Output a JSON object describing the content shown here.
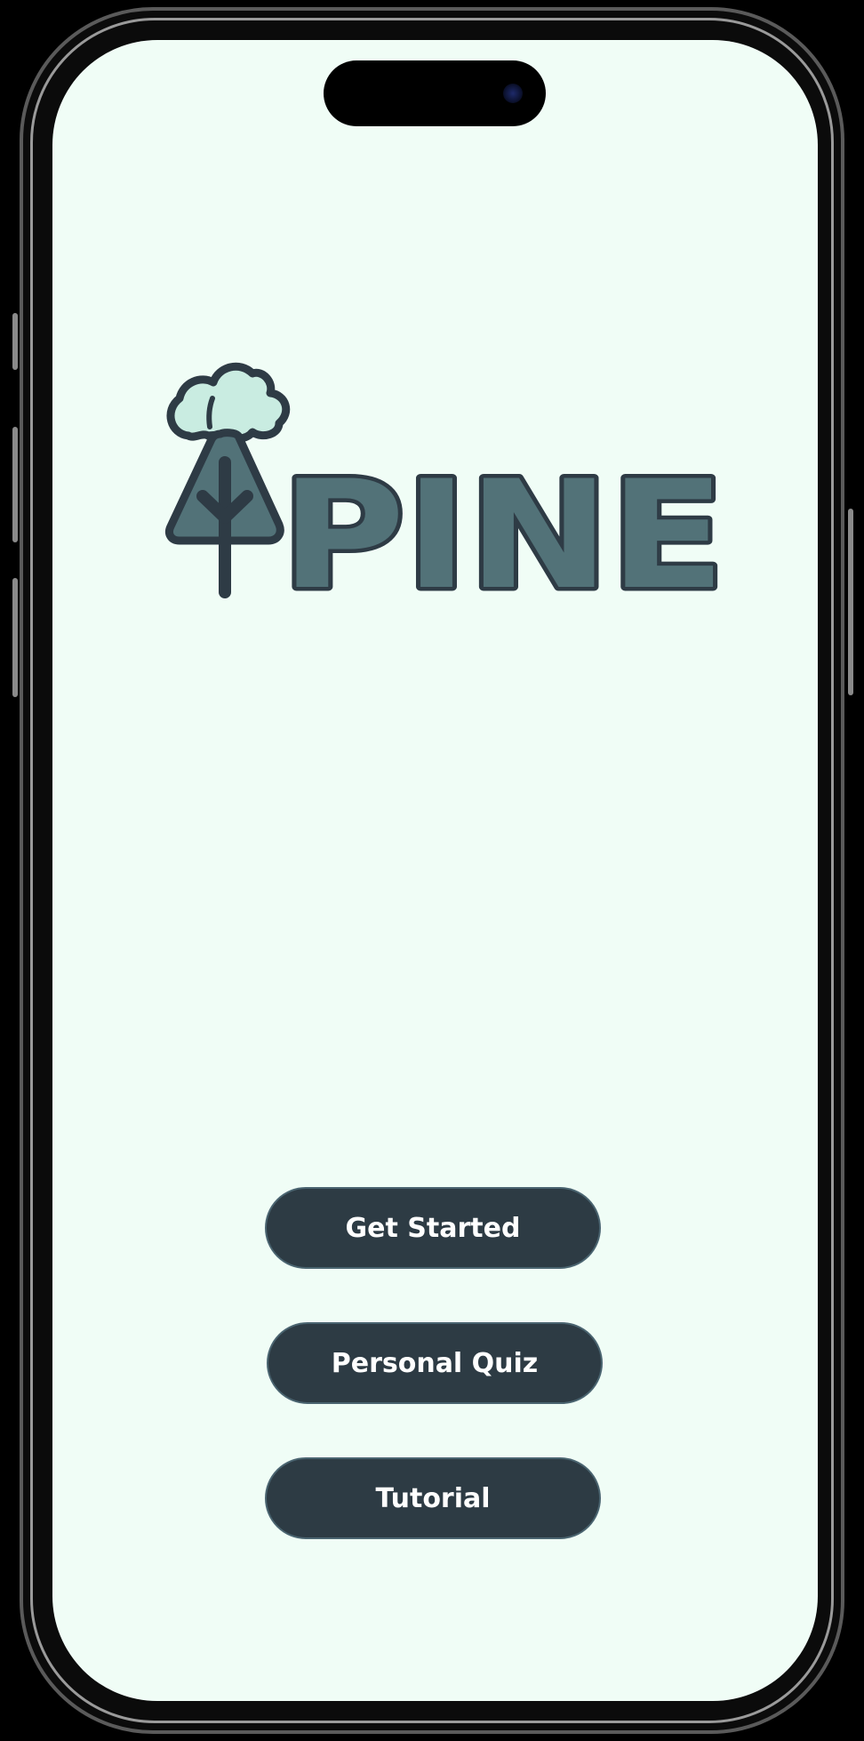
{
  "app": {
    "logo_text": "PINE"
  },
  "buttons": {
    "get_started": "Get Started",
    "personal_quiz": "Personal Quiz",
    "tutorial": "Tutorial"
  },
  "colors": {
    "screen_background": "#f0fdf6",
    "button_fill": "#2d3b44",
    "logo_fill": "#527278",
    "logo_outline": "#2e3b45",
    "cloud_fill": "#c9ece1"
  },
  "icons": {
    "logo": "pine-tree-icon"
  }
}
